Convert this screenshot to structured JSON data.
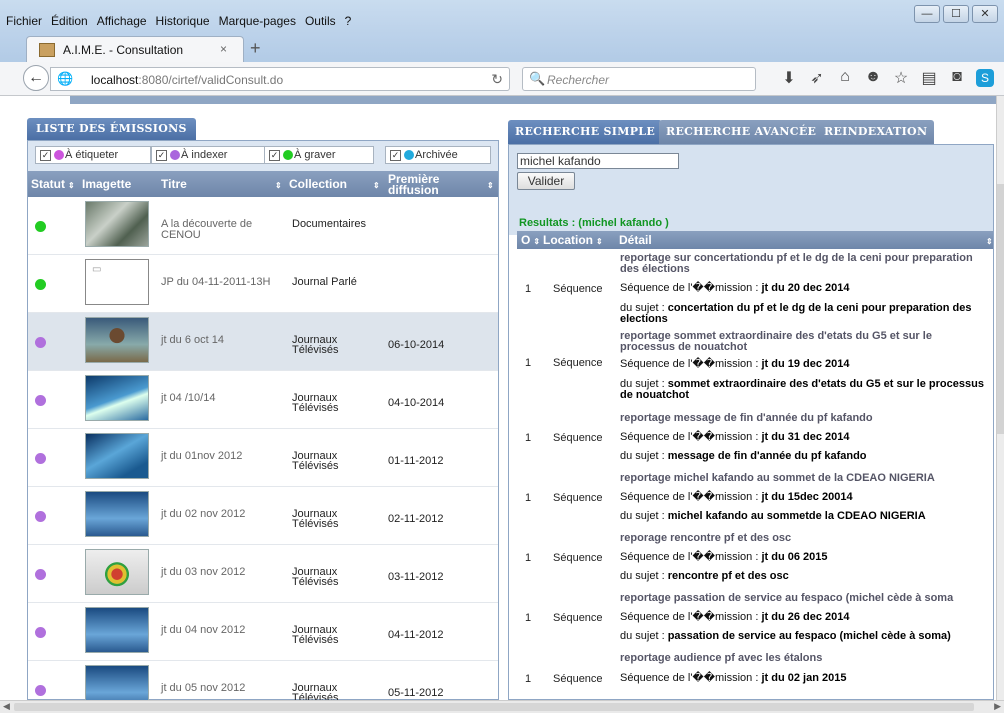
{
  "menubar": {
    "items": [
      "Fichier",
      "Édition",
      "Affichage",
      "Historique",
      "Marque-pages",
      "Outils",
      "?"
    ]
  },
  "window_controls": {
    "minimize": "—",
    "maximize": "☐",
    "close": "✕"
  },
  "browser_tab": {
    "title": "A.I.M.E. - Consultation",
    "close": "×",
    "new_tab": "+"
  },
  "navbar": {
    "back": "←",
    "url_host": "localhost",
    "url_path": ":8080/cirtef/validConsult.do",
    "search_placeholder": "Rechercher"
  },
  "toolbar_icons": [
    "download-icon",
    "send-icon",
    "home-icon",
    "chat-icon",
    "bookmark-star-icon",
    "reading-list-icon",
    "pocket-icon",
    "skype-icon",
    "menu-icon"
  ],
  "left_panel": {
    "title": "LISTE DES ÉMISSIONS",
    "filters": [
      {
        "label": "À étiqueter",
        "color": "#cc55dd",
        "checked": true
      },
      {
        "label": "À indexer",
        "color": "#aa66dd",
        "checked": true
      },
      {
        "label": "À graver",
        "color": "#22cc22",
        "checked": true
      },
      {
        "label": "Archivée",
        "color": "#22aadd",
        "checked": true
      }
    ],
    "columns": {
      "statut": "Statut",
      "imagette": "Imagette",
      "titre": "Titre",
      "collection": "Collection",
      "premiere_1": "Première",
      "premiere_2": "diffusion"
    },
    "rows": [
      {
        "status_color": "#22cc22",
        "title": "A la découverte de CENOU",
        "collection": "Documentaires",
        "date": "",
        "thumb": "photo"
      },
      {
        "status_color": "#22cc22",
        "title": "JP du 04-11-2011-13H",
        "collection": "Journal Parlé",
        "date": "",
        "thumb": "blank"
      },
      {
        "status_color": "#b070dd",
        "title": "jt du 6 oct 14",
        "collection": "Journaux Télévisés",
        "date": "06-10-2014",
        "thumb": "person"
      },
      {
        "status_color": "#b070dd",
        "title": "jt 04 /10/14",
        "collection": "Journaux Télévisés",
        "date": "04-10-2014",
        "thumb": "map"
      },
      {
        "status_color": "#b070dd",
        "title": "jt du 01nov 2012",
        "collection": "Journaux Télévisés",
        "date": "01-11-2012",
        "thumb": "map"
      },
      {
        "status_color": "#b070dd",
        "title": "jt du 02 nov 2012",
        "collection": "Journaux Télévisés",
        "date": "02-11-2012",
        "thumb": "studio"
      },
      {
        "status_color": "#b070dd",
        "title": "jt du 03 nov 2012",
        "collection": "Journaux Télévisés",
        "date": "03-11-2012",
        "thumb": "globe"
      },
      {
        "status_color": "#b070dd",
        "title": "jt du 04 nov 2012",
        "collection": "Journaux Télévisés",
        "date": "04-11-2012",
        "thumb": "studio"
      },
      {
        "status_color": "#b070dd",
        "title": "jt du 05 nov 2012",
        "collection": "Journaux Télévisés",
        "date": "05-11-2012",
        "thumb": "studio"
      }
    ]
  },
  "right_panel": {
    "tabs": [
      "RECHERCHE SIMPLE",
      "RECHERCHE AVANCÉE",
      "REINDEXATION"
    ],
    "query": "michel kafando",
    "submit_label": "Valider",
    "results_label": "Resultats : (michel kafando )",
    "columns": {
      "o": "O",
      "location": "Location",
      "detail": "Détail"
    },
    "results": [
      {
        "num": "1",
        "location": "Séquence",
        "title": "reportage sur concertationdu pf et le dg de la ceni pour preparation des élections",
        "emission_prefix": "Séquence de l'��mission : ",
        "emission": "jt du 20 dec 2014",
        "sujet_prefix": "du sujet : ",
        "sujet": "concertation du pf et le dg de la ceni pour preparation des elections"
      },
      {
        "num": "1",
        "location": "Séquence",
        "title": "reportage sommet extraordinaire des d'etats du G5 et sur le processus de nouatchot",
        "emission_prefix": "Séquence de l'��mission : ",
        "emission": "jt du 19 dec 2014",
        "sujet_prefix": "du sujet : ",
        "sujet": "sommet extraordinaire des d'etats du G5 et sur le processus de nouatchot"
      },
      {
        "num": "1",
        "location": "Séquence",
        "title": "reportage message de fin d'année du pf kafando",
        "emission_prefix": "Séquence de l'��mission : ",
        "emission": "jt du 31 dec 2014",
        "sujet_prefix": "du sujet : ",
        "sujet": "message de fin d'année du pf kafando"
      },
      {
        "num": "1",
        "location": "Séquence",
        "title": "reportage michel kafando au sommet de la CDEAO NIGERIA",
        "emission_prefix": "Séquence de l'��mission : ",
        "emission": "jt du 15dec 20014",
        "sujet_prefix": "du sujet : ",
        "sujet": "michel kafando au sommetde la CDEAO NIGERIA"
      },
      {
        "num": "1",
        "location": "Séquence",
        "title": "reporage rencontre pf et des osc",
        "emission_prefix": "Séquence de l'��mission : ",
        "emission": "jt du 06 2015",
        "sujet_prefix": "du sujet : ",
        "sujet": "rencontre pf et des osc"
      },
      {
        "num": "1",
        "location": "Séquence",
        "title": "reportage passation de service au fespaco (michel cède à soma",
        "emission_prefix": "Séquence de l'��mission : ",
        "emission": "jt du 26 dec 2014",
        "sujet_prefix": "du sujet : ",
        "sujet": "passation de service au fespaco (michel cède à soma)"
      },
      {
        "num": "1",
        "location": "Séquence",
        "title": "reportage audience pf avec les étalons",
        "emission_prefix": "Séquence de l'��mission : ",
        "emission": "jt du 02 jan 2015",
        "sujet_prefix": "",
        "sujet": ""
      }
    ]
  }
}
